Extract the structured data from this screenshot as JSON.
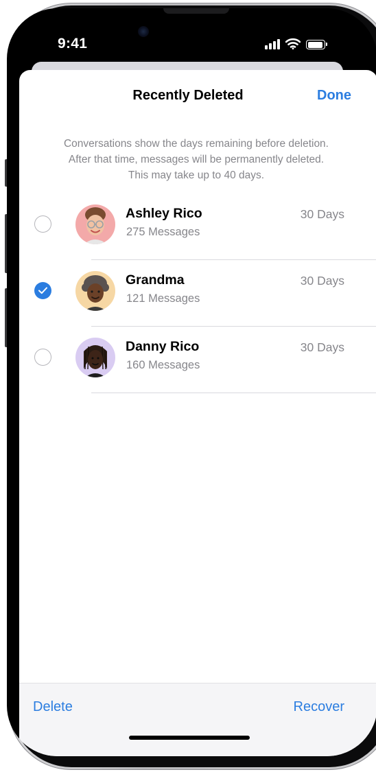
{
  "status_bar": {
    "time": "9:41"
  },
  "nav": {
    "title": "Recently Deleted",
    "done_label": "Done"
  },
  "info": {
    "lines": [
      "Conversations show the days remaining before deletion.",
      "After that time, messages will be permanently deleted.",
      "This may take up to 40 days."
    ]
  },
  "conversations": [
    {
      "name": "Ashley Rico",
      "count": "275 Messages",
      "days": "30 Days",
      "selected": false,
      "avatar": "memoji-glasses-avatar",
      "avatar_bg": "#f3a9a9"
    },
    {
      "name": "Grandma",
      "count": "121 Messages",
      "days": "30 Days",
      "selected": true,
      "avatar": "memoji-grandma-avatar",
      "avatar_bg": "#f6d7a4"
    },
    {
      "name": "Danny Rico",
      "count": "160 Messages",
      "days": "30 Days",
      "selected": false,
      "avatar": "memoji-locs-avatar",
      "avatar_bg": "#d9ccf2"
    }
  ],
  "toolbar": {
    "delete_label": "Delete",
    "recover_label": "Recover"
  },
  "colors": {
    "accent": "#2b7de0",
    "secondary_text": "#86868b",
    "separator": "#d9d9de"
  }
}
